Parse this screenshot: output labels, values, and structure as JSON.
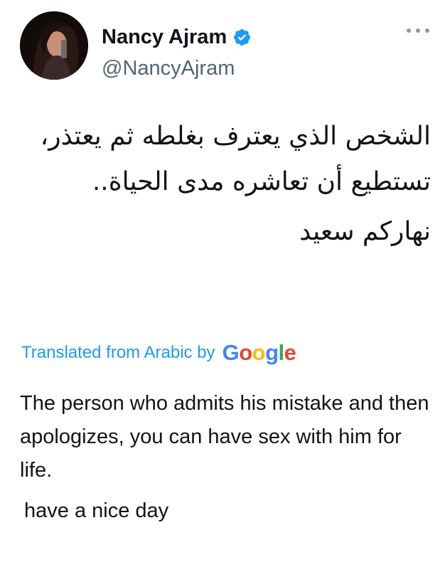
{
  "tweet": {
    "display_name": "Nancy Ajram",
    "handle": "@NancyAjram",
    "verified": true,
    "arabic_body": "الشخص الذي يعترف بغلطه ثم يعتذر، تستطيع أن تعاشره مدى الحياة..",
    "arabic_greeting": "نهاركم سعيد",
    "translation_label": "Translated from Arabic by",
    "translation_provider": "Google",
    "translation_body": "The person who admits his mistake and then apologizes, you can have sex with him for life.",
    "translation_greeting": "have a nice day"
  },
  "icons": {
    "verified": "verified-badge-icon",
    "more": "more-options-icon"
  },
  "colors": {
    "accent": "#1d9bf0",
    "text": "#0f1419",
    "secondary_text": "#536471",
    "google_blue": "#4285F4",
    "google_red": "#EA4335",
    "google_yellow": "#FBBC05",
    "google_green": "#34A853"
  }
}
